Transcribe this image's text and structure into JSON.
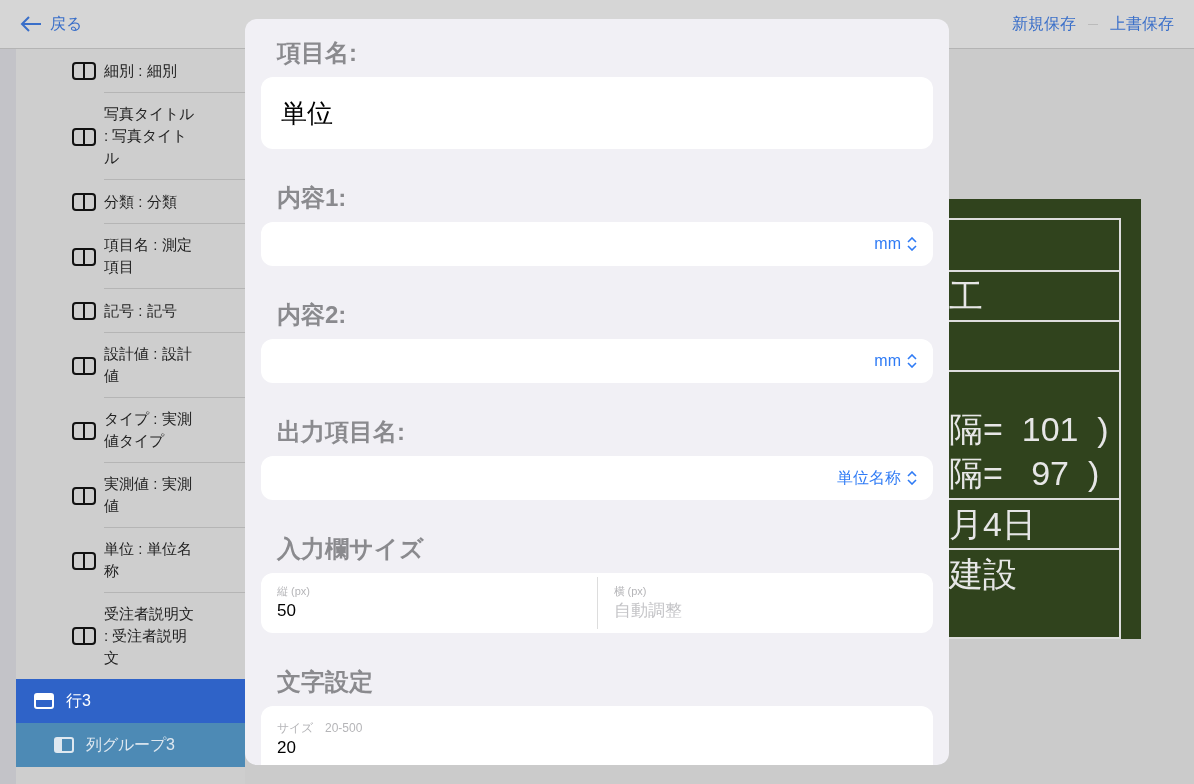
{
  "nav": {
    "back": "戻る",
    "actions": [
      "新規保存",
      "上書保存"
    ]
  },
  "sidebar": {
    "items": [
      {
        "label": "細別 : 細別"
      },
      {
        "label": "写真タイトル : 写真タイトル"
      },
      {
        "label": "分類 : 分類"
      },
      {
        "label": "項目名 : 測定項目"
      },
      {
        "label": "記号 : 記号"
      },
      {
        "label": "設計値 : 設計値"
      },
      {
        "label": "タイプ : 実測値タイプ"
      },
      {
        "label": "実測値 : 実測値"
      },
      {
        "label": "単位 : 単位名称"
      },
      {
        "label": "受注者説明文 : 受注者説明文"
      }
    ],
    "groups": [
      {
        "label": "行3",
        "kind": "row",
        "selected": true
      },
      {
        "label": "列グループ3",
        "kind": "column-group",
        "selected": false
      }
    ]
  },
  "board": {
    "rows": [
      {
        "lines": []
      },
      {
        "lines": [
          "工"
        ]
      },
      {
        "lines": []
      },
      {
        "lines": [
          "隔=  101  )",
          "隔=   97  )"
        ]
      },
      {
        "lines": [
          "月4日"
        ]
      },
      {
        "lines": [
          "建設"
        ]
      }
    ]
  },
  "modal": {
    "sections": [
      {
        "kind": "text",
        "title": "項目名:",
        "value": "単位"
      },
      {
        "kind": "select",
        "title": "内容1:",
        "value": "mm"
      },
      {
        "kind": "select",
        "title": "内容2:",
        "value": "mm"
      },
      {
        "kind": "select",
        "title": "出力項目名:",
        "value": "単位名称"
      },
      {
        "kind": "pair",
        "title": "入力欄サイズ",
        "fields": [
          {
            "label": "縦 (px)",
            "value": "50"
          },
          {
            "label": "横 (px)",
            "placeholder": "自動調整"
          }
        ]
      },
      {
        "kind": "numeric",
        "title": "文字設定",
        "label": "サイズ　20-500",
        "value": "20"
      }
    ]
  }
}
